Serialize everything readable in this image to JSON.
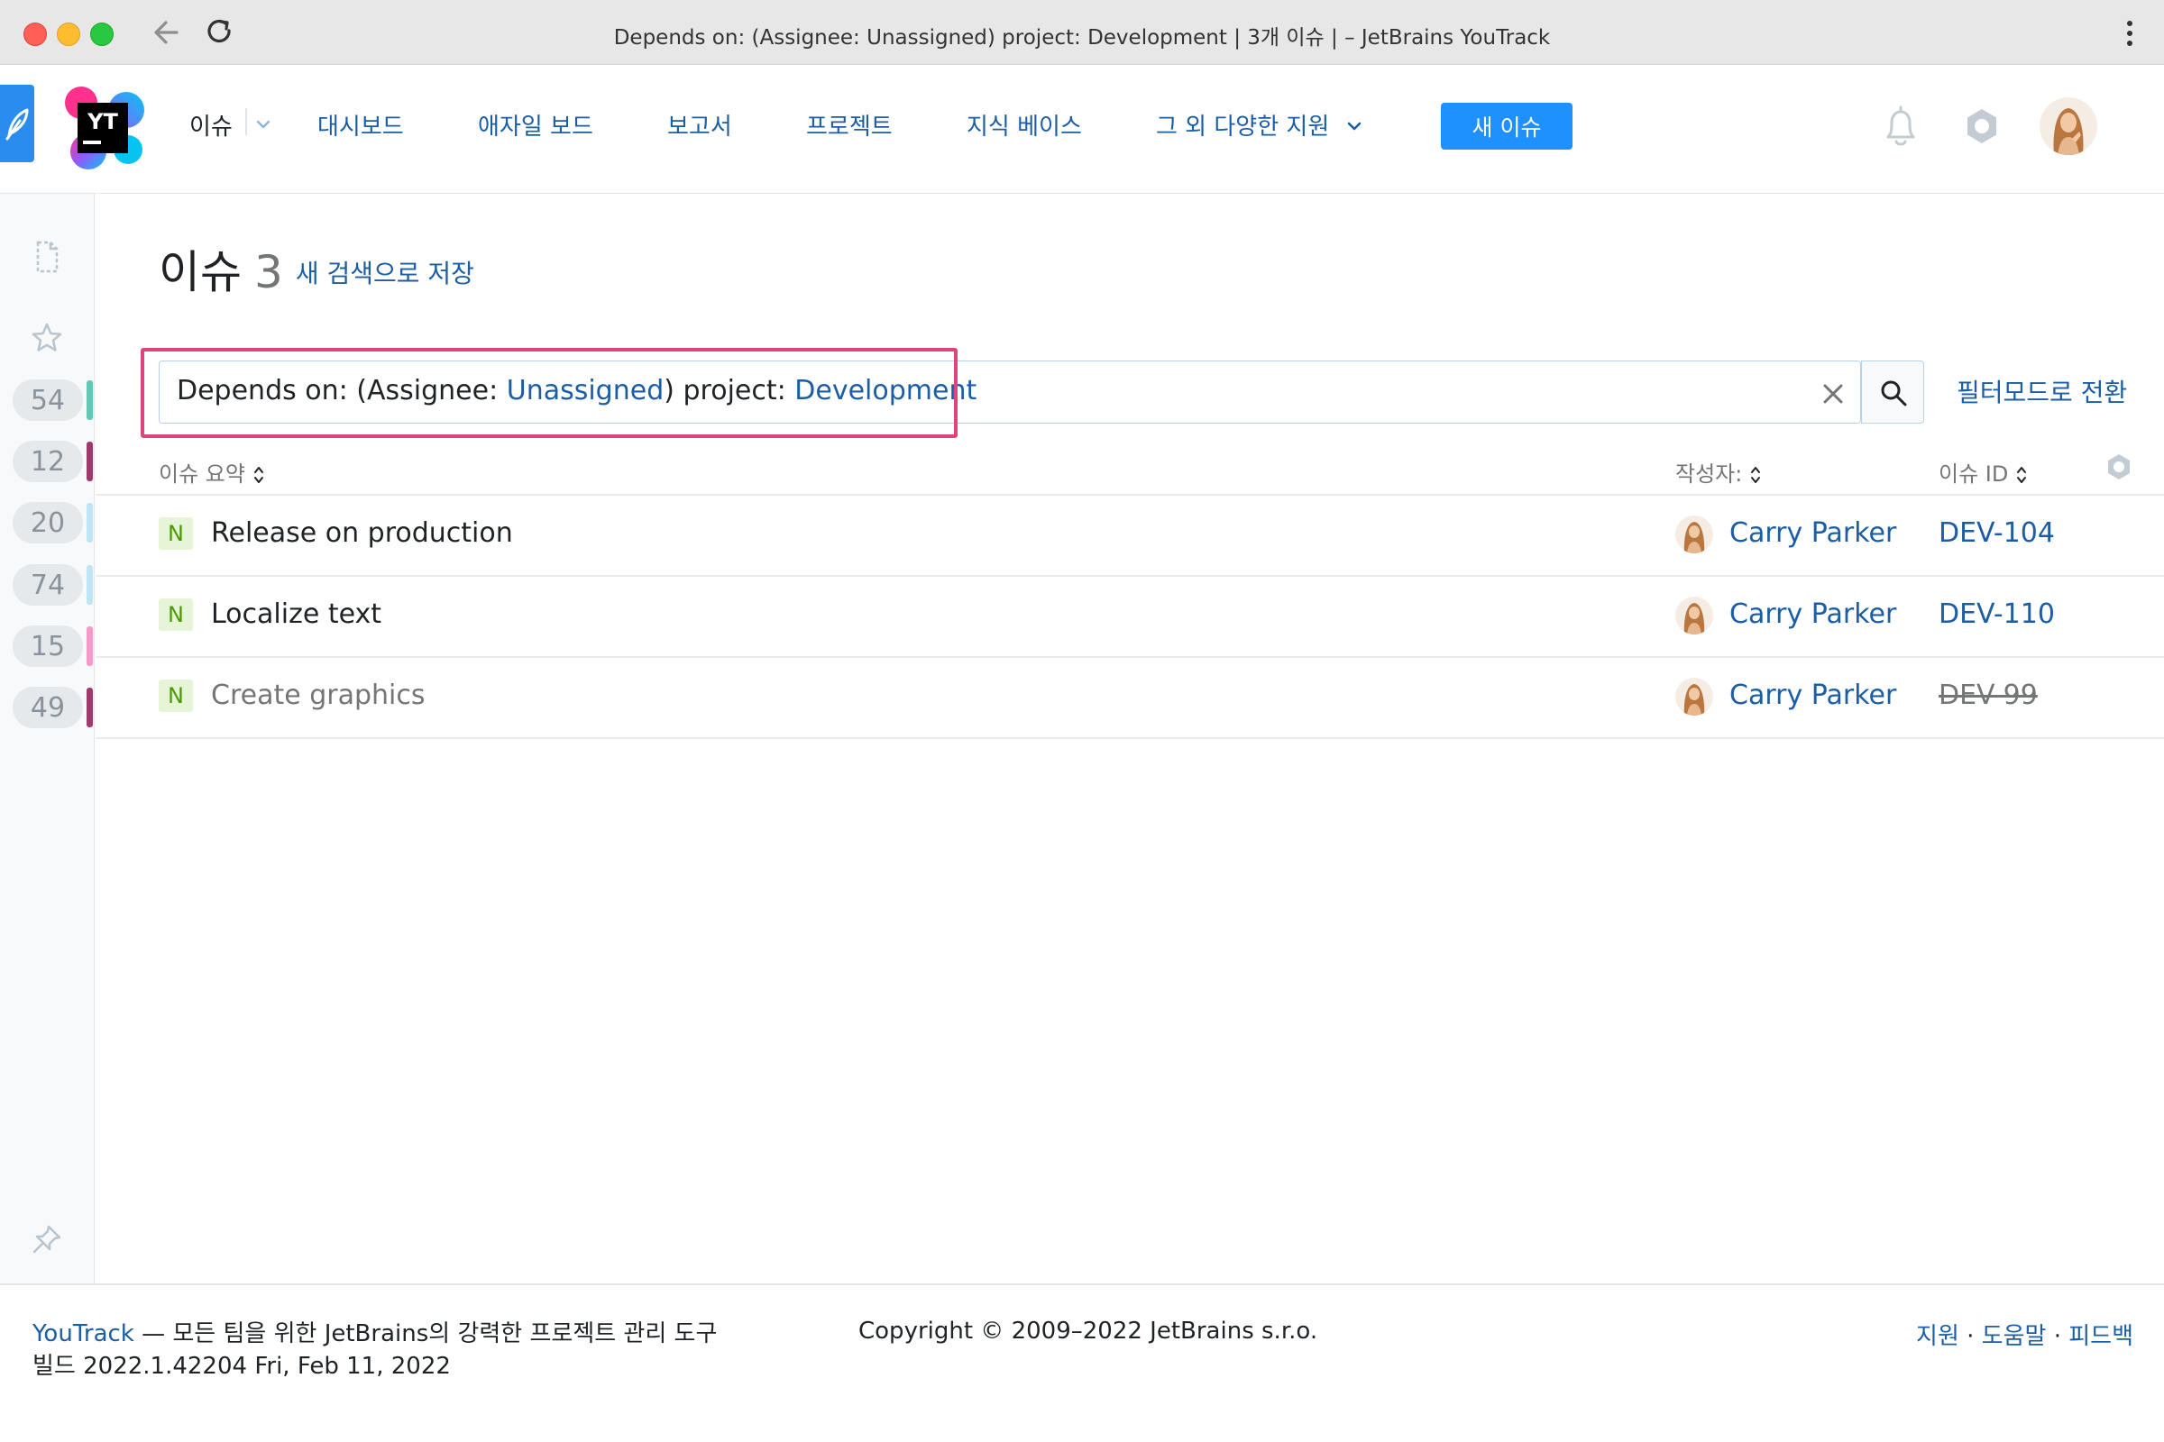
{
  "browser": {
    "window_title": "Depends on: (Assignee: Unassigned) project: Development | 3개 이슈 | – JetBrains YouTrack"
  },
  "header": {
    "logo_text": "YT",
    "nav": {
      "issues": "이슈",
      "dashboards": "대시보드",
      "agile_boards": "애자일 보드",
      "reports": "보고서",
      "projects": "프로젝트",
      "knowledge_base": "지식 베이스",
      "more": "그 외 다양한 지원"
    },
    "new_issue_label": "새 이슈"
  },
  "sidebar": {
    "counters": [
      {
        "count": "54",
        "color": "#5fc9b5"
      },
      {
        "count": "12",
        "color": "#a03a6d"
      },
      {
        "count": "20",
        "color": "#bfe6f5"
      },
      {
        "count": "74",
        "color": "#bfe6f5"
      },
      {
        "count": "15",
        "color": "#f59ac8"
      },
      {
        "count": "49",
        "color": "#a03a6d"
      }
    ]
  },
  "main": {
    "title": "이슈",
    "issue_count": "3",
    "save_search_link": "새 검색으로 저장",
    "search": {
      "part1": "Depends on: (Assignee: ",
      "assignee_value": "Unassigned",
      "part2": ") project: ",
      "project_value": "Development"
    },
    "filter_mode_link": "필터모드로 전환"
  },
  "table": {
    "columns": {
      "summary": "이슈 요약",
      "reporter": "작성자:",
      "issue_id": "이슈 ID"
    },
    "rows": [
      {
        "state": "N",
        "summary": "Release on production",
        "reporter": "Carry Parker",
        "id": "DEV-104",
        "resolved": false
      },
      {
        "state": "N",
        "summary": "Localize text",
        "reporter": "Carry Parker",
        "id": "DEV-110",
        "resolved": false
      },
      {
        "state": "N",
        "summary": "Create graphics",
        "reporter": "Carry Parker",
        "id": "DEV-99",
        "resolved": true
      }
    ]
  },
  "footer": {
    "product_link": "YouTrack",
    "tagline": " — 모든 팀을 위한 JetBrains의 강력한 프로젝트 관리 도구",
    "build": "빌드 2022.1.42204 Fri, Feb 11, 2022",
    "copyright": "Copyright © 2009–2022 JetBrains s.r.o.",
    "links": [
      "지원",
      "도움말",
      "피드백"
    ],
    "link_separator": " · "
  },
  "colors": {
    "accent": "#1e90ff",
    "link": "#1b5ea5",
    "highlight": "#e0447f"
  }
}
